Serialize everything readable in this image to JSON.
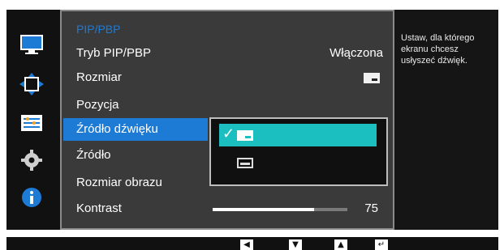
{
  "panel": {
    "title": "PIP/PBP",
    "rows": [
      {
        "label": "Tryb PIP/PBP",
        "value": "Włączona"
      },
      {
        "label": "Rozmiar"
      },
      {
        "label": "Pozycja"
      },
      {
        "label": "Źródło dźwięku"
      },
      {
        "label": "Źródło"
      },
      {
        "label": "Rozmiar obrazu"
      },
      {
        "label": "Kontrast",
        "value": "75"
      }
    ],
    "contrast_level": 75
  },
  "popup": {
    "options": [
      "main-screen-audio",
      "sub-screen-audio"
    ],
    "selected_index": 0
  },
  "help": {
    "text": "Ustaw, dla którego ekranu chcesz usłyszeć dźwięk."
  },
  "sidebar": {
    "icons": [
      "monitor-icon",
      "resize-arrows-icon",
      "settings-list-icon",
      "gear-icon",
      "info-icon"
    ],
    "accent": "#1d7bd6"
  },
  "bottom_bar": {
    "buttons": [
      "left-arrow-icon",
      "down-arrow-icon",
      "up-arrow-icon",
      "enter-icon"
    ]
  }
}
